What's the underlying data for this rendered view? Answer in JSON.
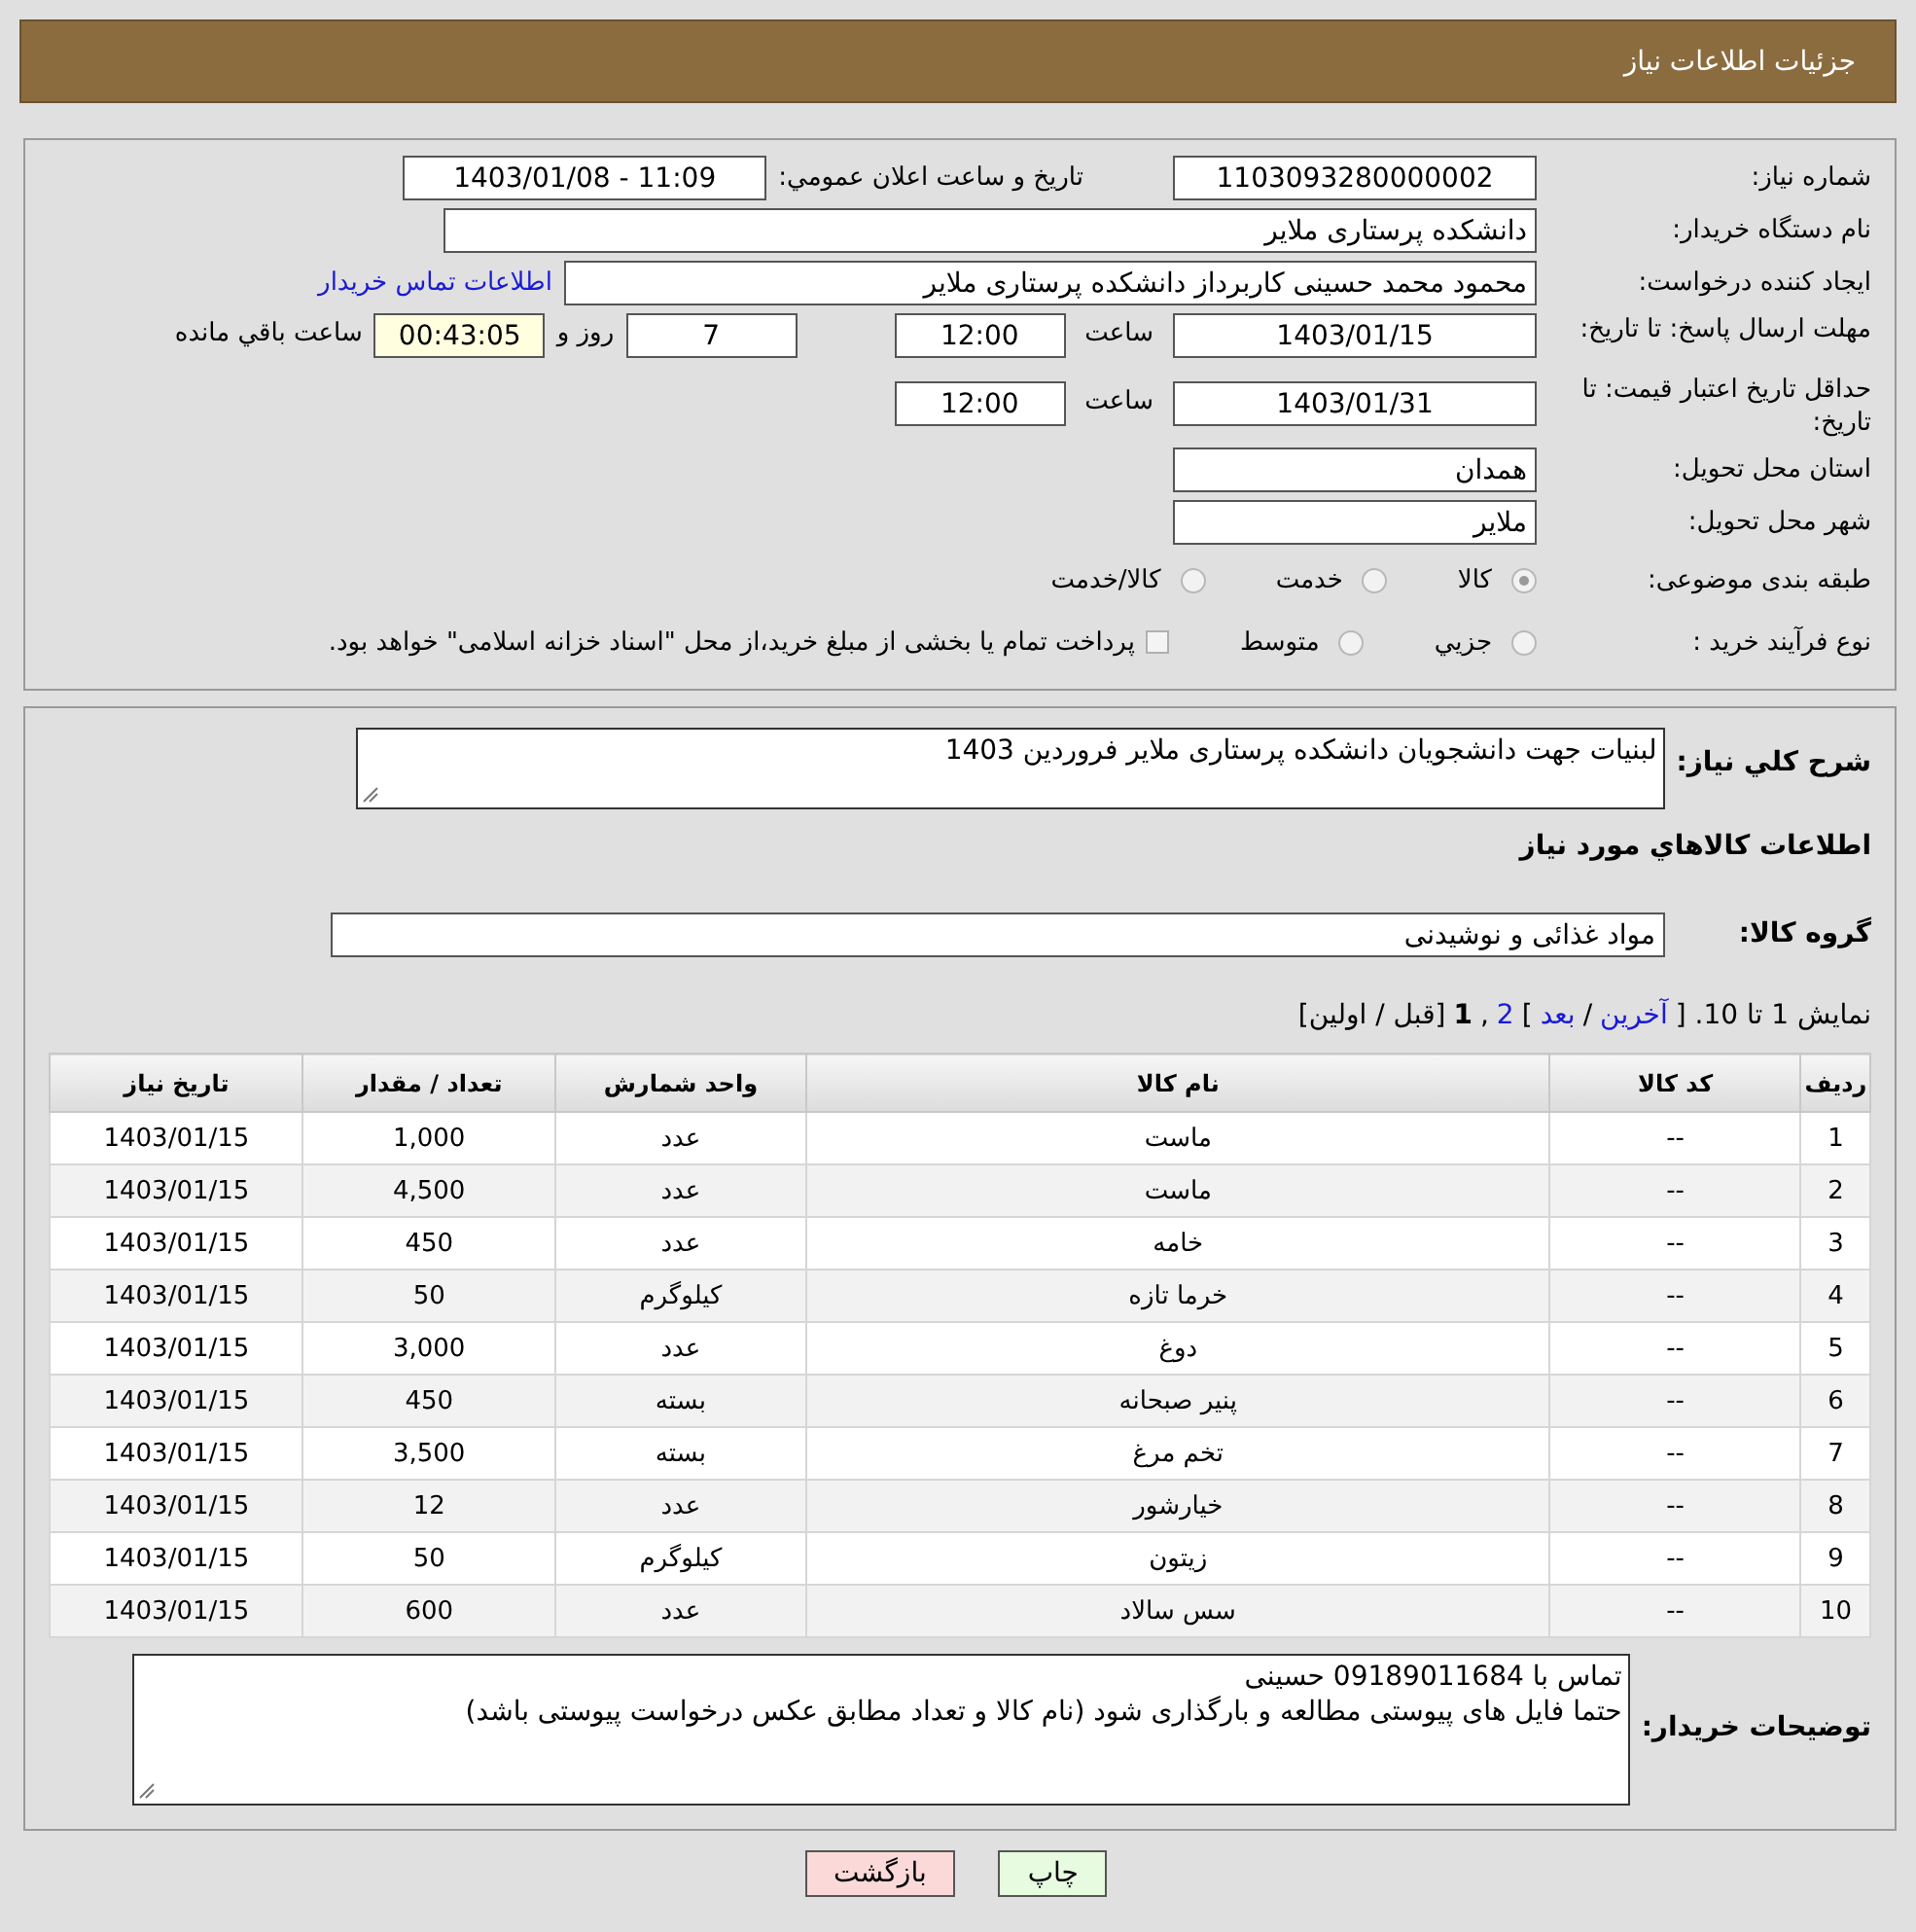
{
  "header": {
    "title": "جزئیات اطلاعات نیاز"
  },
  "form": {
    "need_number": {
      "label": "شماره نیاز:",
      "value": "1103093280000002"
    },
    "announce": {
      "label": "تاريخ و ساعت اعلان عمومي:",
      "value": "1403/01/08 - 11:09"
    },
    "buyer": {
      "label": "نام دستگاه خريدار:",
      "value": "دانشکده پرستاری ملایر"
    },
    "creator": {
      "label": "ایجاد کننده درخواست:",
      "value": "محمود محمد حسینی کاربرداز دانشکده پرستاری ملایر",
      "link": "اطلاعات تماس خریدار"
    },
    "deadline": {
      "label": "مهلت ارسال پاسخ: تا تاریخ:",
      "date": "1403/01/15",
      "time_label": "ساعت",
      "time": "12:00",
      "days": "7",
      "days_label": "روز و",
      "remaining": "00:43:05",
      "remaining_label": "ساعت باقي مانده"
    },
    "validity": {
      "label": "حداقل تاریخ اعتبار قیمت: تا تاریخ:",
      "date": "1403/01/31",
      "time_label": "ساعت",
      "time": "12:00"
    },
    "province": {
      "label": "استان محل تحویل:",
      "value": "همدان"
    },
    "city": {
      "label": "شهر محل تحویل:",
      "value": "ملایر"
    },
    "category": {
      "label": "طبقه بندی موضوعی:",
      "options": [
        {
          "label": "کالا",
          "selected": true
        },
        {
          "label": "خدمت",
          "selected": false
        },
        {
          "label": "کالا/خدمت",
          "selected": false
        }
      ]
    },
    "purchase": {
      "label": "نوع فرآیند خرید :",
      "options": [
        {
          "label": "جزيي",
          "selected": false
        },
        {
          "label": "متوسط",
          "selected": false
        }
      ],
      "payment": {
        "label": "پرداخت تمام یا بخشی از مبلغ خرید،از محل \"اسناد خزانه اسلامی\" خواهد بود.",
        "checked": false
      }
    }
  },
  "details": {
    "summary_label": "شرح کلي نياز:",
    "summary": "لبنیات جهت دانشجویان دانشکده پرستاری ملایر فروردین 1403",
    "goods_title": "اطلاعات کالاهاي مورد نياز",
    "group_label": "گروه کالا:",
    "group": "مواد غذائی و نوشیدنی",
    "pagination": [
      {
        "kind": "text",
        "text": "نمایش 1 تا 10. ["
      },
      {
        "kind": "link",
        "text": "آخرین"
      },
      {
        "kind": "text",
        "text": "/"
      },
      {
        "kind": "link",
        "text": "بعد"
      },
      {
        "kind": "text",
        "text": "]"
      },
      {
        "kind": "link",
        "text": "2"
      },
      {
        "kind": "text",
        "text": ","
      },
      {
        "kind": "current",
        "text": "1"
      },
      {
        "kind": "text",
        "text": "[قبل / اولین]"
      }
    ],
    "table": {
      "columns": [
        "رديف",
        "کد کالا",
        "نام کالا",
        "واحد شمارش",
        "تعداد / مقدار",
        "تاریخ نیاز"
      ],
      "rows": [
        [
          "1",
          "--",
          "ماست",
          "عدد",
          "1,000",
          "1403/01/15"
        ],
        [
          "2",
          "--",
          "ماست",
          "عدد",
          "4,500",
          "1403/01/15"
        ],
        [
          "3",
          "--",
          "خامه",
          "عدد",
          "450",
          "1403/01/15"
        ],
        [
          "4",
          "--",
          "خرما تازه",
          "کیلوگرم",
          "50",
          "1403/01/15"
        ],
        [
          "5",
          "--",
          "دوغ",
          "عدد",
          "3,000",
          "1403/01/15"
        ],
        [
          "6",
          "--",
          "پنیر صبحانه",
          "بسته",
          "450",
          "1403/01/15"
        ],
        [
          "7",
          "--",
          "تخم مرغ",
          "بسته",
          "3,500",
          "1403/01/15"
        ],
        [
          "8",
          "--",
          "خیارشور",
          "عدد",
          "12",
          "1403/01/15"
        ],
        [
          "9",
          "--",
          "زیتون",
          "کیلوگرم",
          "50",
          "1403/01/15"
        ],
        [
          "10",
          "--",
          "سس سالاد",
          "عدد",
          "600",
          "1403/01/15"
        ]
      ]
    },
    "notes_label": "توضیحات خریدار:",
    "notes": [
      "تماس با 09189011684 حسینی",
      "حتما فایل های پیوستی مطالعه و بارگذاری شود (نام کالا و تعداد مطابق عکس درخواست پیوستی باشد)"
    ]
  },
  "buttons": [
    {
      "kind": "print",
      "label": "چاپ"
    },
    {
      "kind": "back",
      "label": "بازگشت"
    }
  ]
}
